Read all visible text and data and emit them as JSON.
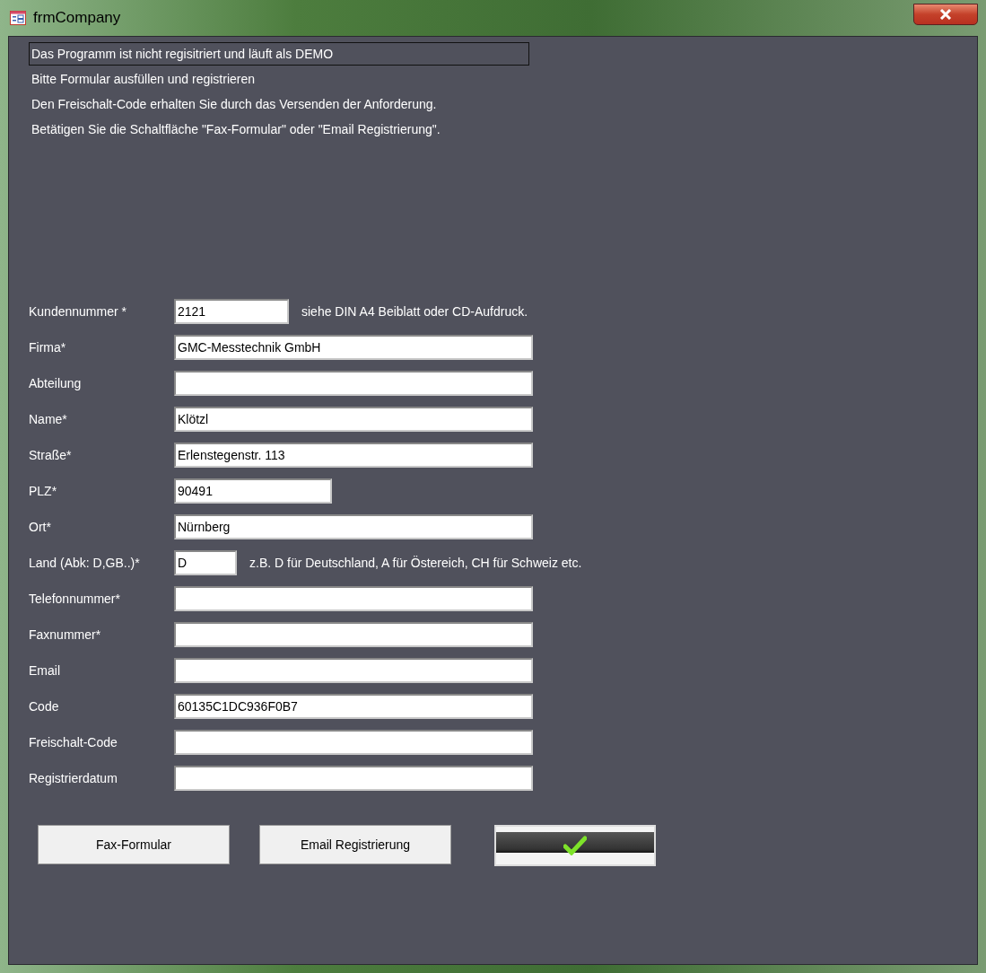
{
  "window": {
    "title": "frmCompany"
  },
  "notices": [
    {
      "text": "Das Programm ist nicht regisitriert und läuft als DEMO",
      "boxed": true
    },
    {
      "text": "Bitte Formular ausfüllen und registrieren",
      "boxed": false
    },
    {
      "text": "Den Freischalt-Code erhalten Sie durch das Versenden der Anforderung.",
      "boxed": false
    },
    {
      "text": "Betätigen Sie die Schaltfläche \"Fax-Formular\" oder \"Email Registrierung\".",
      "boxed": false
    }
  ],
  "fields": [
    {
      "label": "Kundennummer *",
      "value": "2121",
      "kind": "short",
      "hint": "siehe DIN A4 Beiblatt oder CD-Aufdruck."
    },
    {
      "label": "Firma*",
      "value": "GMC-Messtechnik GmbH",
      "kind": "long"
    },
    {
      "label": "Abteilung",
      "kind": "long"
    },
    {
      "label": "Name*",
      "value": "Klötzl",
      "kind": "long"
    },
    {
      "label": "Straße*",
      "value": "Erlenstegenstr. 113",
      "kind": "long"
    },
    {
      "label": "PLZ*",
      "value": "90491",
      "kind": "medium"
    },
    {
      "label": "Ort*",
      "value": "Nürnberg",
      "kind": "long"
    },
    {
      "label": "Land (Abk: D,GB..)*",
      "value": "D",
      "kind": "tiny",
      "hint": "z.B. D für Deutschland, A für Östereich, CH für Schweiz etc."
    },
    {
      "label": "Telefonnummer*",
      "kind": "long"
    },
    {
      "label": "Faxnummer*",
      "kind": "long"
    },
    {
      "label": "Email",
      "kind": "long"
    },
    {
      "label": "Code",
      "value": "60135C1DC936F0B7",
      "kind": "long"
    },
    {
      "label": "Freischalt-Code",
      "kind": "long"
    },
    {
      "label": "Registrierdatum",
      "kind": "long"
    }
  ],
  "buttons": [
    {
      "label": "Fax-Formular",
      "kind": "text"
    },
    {
      "label": "Email Registrierung",
      "kind": "text"
    },
    {
      "kind": "check"
    }
  ]
}
